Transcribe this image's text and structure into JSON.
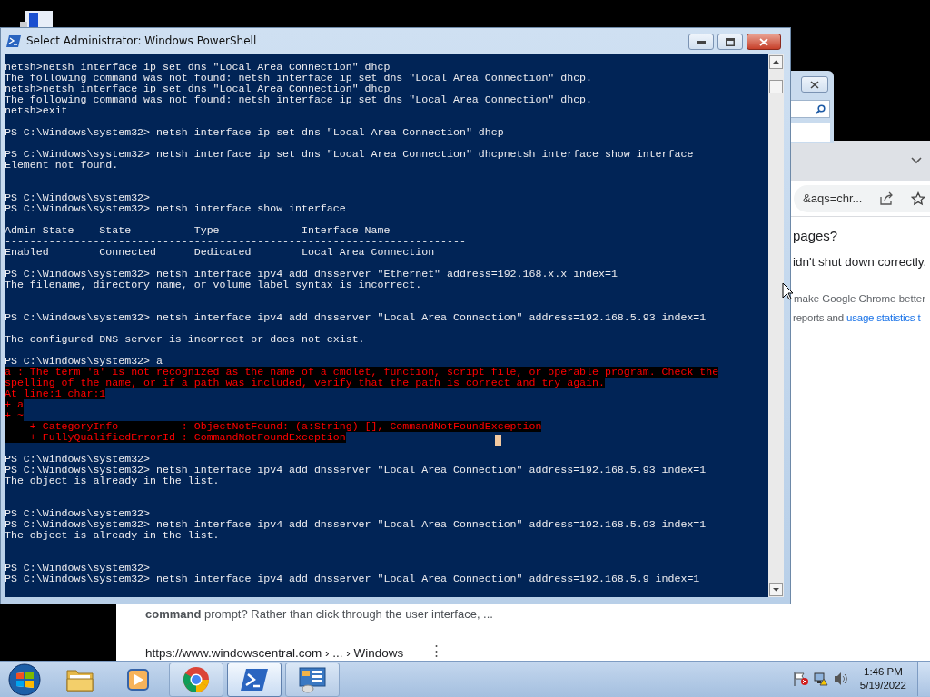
{
  "powershell_window": {
    "title": "Select Administrator: Windows PowerShell",
    "lines": [
      {
        "kind": "output",
        "text": "netsh>netsh interface ip set dns \"Local Area Connection\" dhcp"
      },
      {
        "kind": "output",
        "text": "The following command was not found: netsh interface ip set dns \"Local Area Connection\" dhcp."
      },
      {
        "kind": "output",
        "text": "netsh>netsh interface ip set dns \"Local Area Connection\" dhcp"
      },
      {
        "kind": "output",
        "text": "The following command was not found: netsh interface ip set dns \"Local Area Connection\" dhcp."
      },
      {
        "kind": "output",
        "text": "netsh>exit"
      },
      {
        "kind": "blank"
      },
      {
        "kind": "output",
        "text": "PS C:\\Windows\\system32> netsh interface ip set dns \"Local Area Connection\" dhcp"
      },
      {
        "kind": "blank"
      },
      {
        "kind": "output",
        "text": "PS C:\\Windows\\system32> netsh interface ip set dns \"Local Area Connection\" dhcpnetsh interface show interface"
      },
      {
        "kind": "output",
        "text": "Element not found."
      },
      {
        "kind": "blank"
      },
      {
        "kind": "blank"
      },
      {
        "kind": "output",
        "text": "PS C:\\Windows\\system32>"
      },
      {
        "kind": "output",
        "text": "PS C:\\Windows\\system32> netsh interface show interface"
      },
      {
        "kind": "blank"
      },
      {
        "kind": "output",
        "text": "Admin State    State          Type             Interface Name"
      },
      {
        "kind": "output",
        "text": "-------------------------------------------------------------------------"
      },
      {
        "kind": "output",
        "text": "Enabled        Connected      Dedicated        Local Area Connection"
      },
      {
        "kind": "blank"
      },
      {
        "kind": "output",
        "text": "PS C:\\Windows\\system32> netsh interface ipv4 add dnsserver \"Ethernet\" address=192.168.x.x index=1"
      },
      {
        "kind": "output",
        "text": "The filename, directory name, or volume label syntax is incorrect."
      },
      {
        "kind": "blank"
      },
      {
        "kind": "blank"
      },
      {
        "kind": "output",
        "text": "PS C:\\Windows\\system32> netsh interface ipv4 add dnsserver \"Local Area Connection\" address=192.168.5.93 index=1"
      },
      {
        "kind": "blank"
      },
      {
        "kind": "output",
        "text": "The configured DNS server is incorrect or does not exist."
      },
      {
        "kind": "blank"
      },
      {
        "kind": "output",
        "text": "PS C:\\Windows\\system32> a"
      },
      {
        "kind": "error",
        "text": "a : The term 'a' is not recognized as the name of a cmdlet, function, script file, or operable program. Check the"
      },
      {
        "kind": "error",
        "text": "spelling of the name, or if a path was included, verify that the path is correct and try again."
      },
      {
        "kind": "error",
        "text": "At line:1 char:1"
      },
      {
        "kind": "error",
        "text": "+ a"
      },
      {
        "kind": "error",
        "text": "+ ~"
      },
      {
        "kind": "error",
        "text": "    + CategoryInfo          : ObjectNotFound: (a:String) [], CommandNotFoundException"
      },
      {
        "kind": "error",
        "text": "    + FullyQualifiedErrorId : CommandNotFoundException"
      },
      {
        "kind": "blank"
      },
      {
        "kind": "output",
        "text": "PS C:\\Windows\\system32>"
      },
      {
        "kind": "output",
        "text": "PS C:\\Windows\\system32> netsh interface ipv4 add dnsserver \"Local Area Connection\" address=192.168.5.93 index=1"
      },
      {
        "kind": "output",
        "text": "The object is already in the list."
      },
      {
        "kind": "blank"
      },
      {
        "kind": "blank"
      },
      {
        "kind": "output",
        "text": "PS C:\\Windows\\system32>"
      },
      {
        "kind": "output",
        "text": "PS C:\\Windows\\system32> netsh interface ipv4 add dnsserver \"Local Area Connection\" address=192.168.5.93 index=1"
      },
      {
        "kind": "output",
        "text": "The object is already in the list."
      },
      {
        "kind": "blank"
      },
      {
        "kind": "blank"
      },
      {
        "kind": "output",
        "text": "PS C:\\Windows\\system32>"
      },
      {
        "kind": "output",
        "text": "PS C:\\Windows\\system32> netsh interface ipv4 add dnsserver \"Local Area Connection\" address=192.168.5.9 index=1"
      }
    ]
  },
  "browser_window": {
    "url_fragment": "&aqs=chr...",
    "heading": "pages?",
    "message": "idn't shut down correctly.",
    "notice_line": "make Google Chrome better",
    "notice_line_2": {
      "text": "reports and ",
      "link": "usage statistics t"
    },
    "snippet": "**command** prompt? Rather than click through the user interface, ...",
    "result_url": "https://www.windowscentral.com › ... › Windows",
    "menu_glyph": "⋮"
  },
  "taskbar": {
    "apps": [
      {
        "kind": "explorer",
        "running": false,
        "selected": false
      },
      {
        "kind": "media",
        "running": false,
        "selected": false
      },
      {
        "kind": "chrome",
        "running": true,
        "selected": false
      },
      {
        "kind": "powershell",
        "running": true,
        "selected": true
      },
      {
        "kind": "server",
        "running": true,
        "selected": false
      }
    ],
    "clock": {
      "time": "1:46 PM",
      "date": "5/19/2022"
    }
  }
}
